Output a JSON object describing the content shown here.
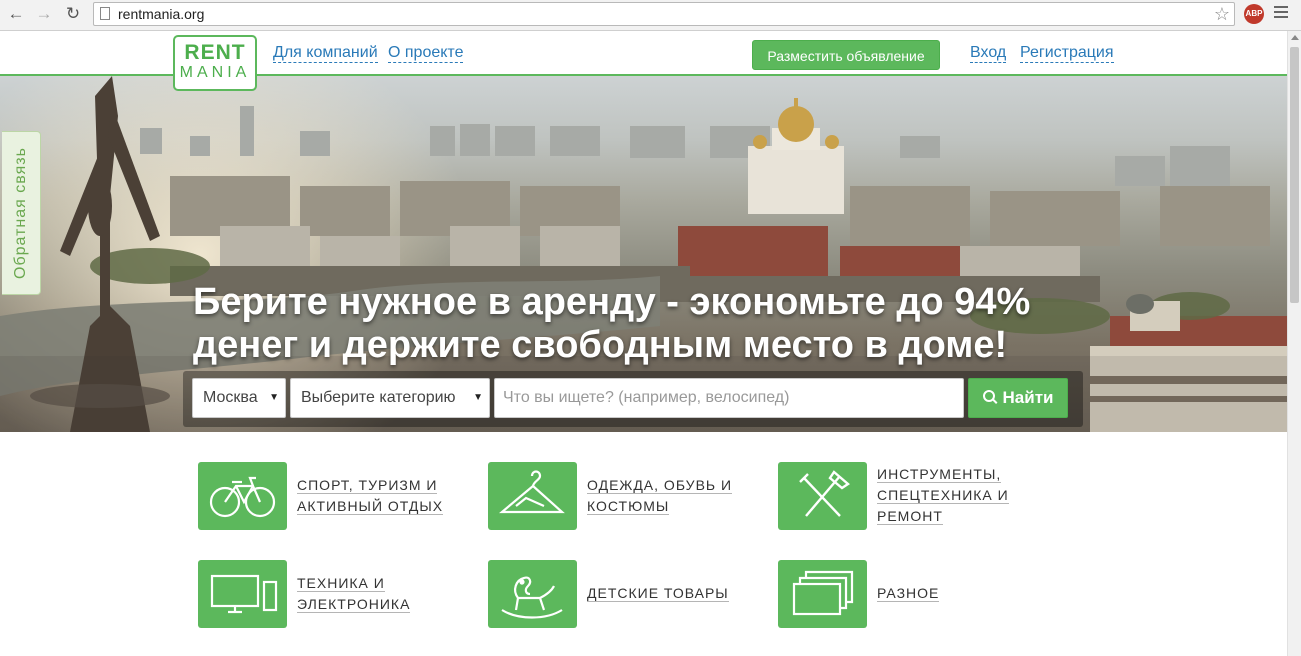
{
  "browser": {
    "url": "rentmania.org",
    "extension_label": "ABP"
  },
  "header": {
    "logo_line1": "RENT",
    "logo_line2": "MANIA",
    "nav_companies": "Для компаний",
    "nav_about": "О проекте",
    "post_ad": "Разместить объявление",
    "login": "Вход",
    "register": "Регистрация"
  },
  "feedback": "Обратная связь",
  "hero": {
    "title_line1": "Берите нужное в аренду - экономьте до 94%",
    "title_line2": "денег и держите свободным место в доме!",
    "city": "Москва",
    "category": "Выберите категорию",
    "search_placeholder": "Что вы ищете? (например, велосипед)",
    "search_button": "Найти"
  },
  "categories": [
    {
      "icon": "bicycle-icon",
      "line1": "Спорт, туризм и",
      "line2": "активный отдых",
      "line3": ""
    },
    {
      "icon": "hanger-icon",
      "line1": "Одежда, обувь и",
      "line2": "костюмы",
      "line3": ""
    },
    {
      "icon": "tools-icon",
      "line1": "Инструменты,",
      "line2": "спецтехника и",
      "line3": "ремонт"
    },
    {
      "icon": "monitor-phone-icon",
      "line1": "Техника и",
      "line2": "электроника",
      "line3": ""
    },
    {
      "icon": "rocking-horse-icon",
      "line1": "Детские товары",
      "line2": "",
      "line3": ""
    },
    {
      "icon": "stacked-cards-icon",
      "line1": "Разное",
      "line2": "",
      "line3": ""
    }
  ],
  "colors": {
    "brand_green": "#5cb85c",
    "link_blue": "#2a7ab8"
  }
}
